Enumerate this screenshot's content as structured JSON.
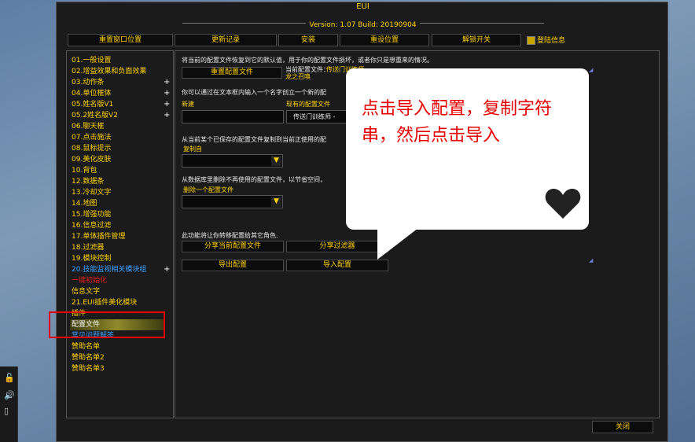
{
  "window": {
    "title": "EUI",
    "version": "Version: 1.07 Build: 20190904",
    "close_label": "关闭"
  },
  "topbar": {
    "buttons": [
      "重置窗口位置",
      "更新记录",
      "安装",
      "重设位置",
      "解锁开关"
    ],
    "login_label": "登陆信息"
  },
  "nav": {
    "items": [
      {
        "label": "01.一般设置",
        "plus": false,
        "color": "#ffd100"
      },
      {
        "label": "02.增益效果和负面效果",
        "plus": false,
        "color": "#ffd100"
      },
      {
        "label": "03.动作条",
        "plus": true,
        "color": "#ffd100"
      },
      {
        "label": "04.单位框体",
        "plus": true,
        "color": "#ffd100"
      },
      {
        "label": "05.姓名版V1",
        "plus": true,
        "color": "#ffd100"
      },
      {
        "label": "05.2姓名版V2",
        "plus": true,
        "color": "#ffd100"
      },
      {
        "label": "06.聊天框",
        "plus": false,
        "color": "#ffd100"
      },
      {
        "label": "07.点击施法",
        "plus": false,
        "color": "#ffd100"
      },
      {
        "label": "08.鼠标提示",
        "plus": false,
        "color": "#ffd100"
      },
      {
        "label": "09.美化皮肤",
        "plus": false,
        "color": "#ffd100"
      },
      {
        "label": "10.背包",
        "plus": false,
        "color": "#ffd100"
      },
      {
        "label": "12.数据条",
        "plus": false,
        "color": "#ffd100"
      },
      {
        "label": "13.冷却文字",
        "plus": false,
        "color": "#ffd100"
      },
      {
        "label": "14.地图",
        "plus": false,
        "color": "#ffd100"
      },
      {
        "label": "15.增强功能",
        "plus": false,
        "color": "#ffd100"
      },
      {
        "label": "16.信息过滤",
        "plus": false,
        "color": "#ffd100"
      },
      {
        "label": "17.单体插件管理",
        "plus": false,
        "color": "#ffd100"
      },
      {
        "label": "18.过滤器",
        "plus": false,
        "color": "#ffd100"
      },
      {
        "label": "19.模块控制",
        "plus": false,
        "color": "#ffd100"
      },
      {
        "label": "20.技能监视相关模块组",
        "plus": true,
        "color": "#3aa0ff"
      },
      {
        "label": "一键初始化",
        "plus": false,
        "color": "#e02020"
      },
      {
        "label": "信息文字",
        "plus": false,
        "color": "#ffd100"
      },
      {
        "label": "21.EUI插件美化模块",
        "plus": false,
        "color": "#ffd100"
      },
      {
        "label": "插件",
        "plus": false,
        "color": "#ffd100"
      },
      {
        "label": "配置文件",
        "plus": false,
        "color": "#ffffff"
      },
      {
        "label": "常见问题解答",
        "plus": false,
        "color": "#3aa0ff"
      },
      {
        "label": "赞助名单",
        "plus": false,
        "color": "#ffd100"
      },
      {
        "label": "赞助名单2",
        "plus": false,
        "color": "#ffd100"
      },
      {
        "label": "赞助名单3",
        "plus": false,
        "color": "#ffd100"
      }
    ]
  },
  "panel": {
    "intro_text": "将当前的配置文件恢复到它的默认值，用于你的配置文件损坏，或者你只是想重来的情况。",
    "reset_button": "重置配置文件",
    "current_profile_label": "当前配置文件：",
    "current_profile_value": "传送门训练师",
    "current_profile_sub": "龙之召唤",
    "new_text": "你可以通过在文本框内输入一个名字创立一个新的配",
    "new_label": "新建",
    "existing_label": "现有的配置文件",
    "existing_value": "传送门训练师 -",
    "copy_text": "从当前某个已保存的配置文件复制到当前正使用的配",
    "copy_label": "复制自",
    "delete_text": "从数据库里删除不再使用的配置文件，以节省空间，",
    "delete_label": "删除一个配置文件",
    "transfer_text": "此功能将让你转移配置给其它角色.",
    "share_profile_button": "分享当前配置文件",
    "share_filter_button": "分享过滤器",
    "export_button": "导出配置",
    "import_button": "导入配置"
  },
  "callout": {
    "text": "点击导入配置，复制字符串，然后点击导入"
  },
  "colors": {
    "accent": "#ffd100",
    "highlight": "#e00000",
    "callout_text": "#e60000"
  }
}
